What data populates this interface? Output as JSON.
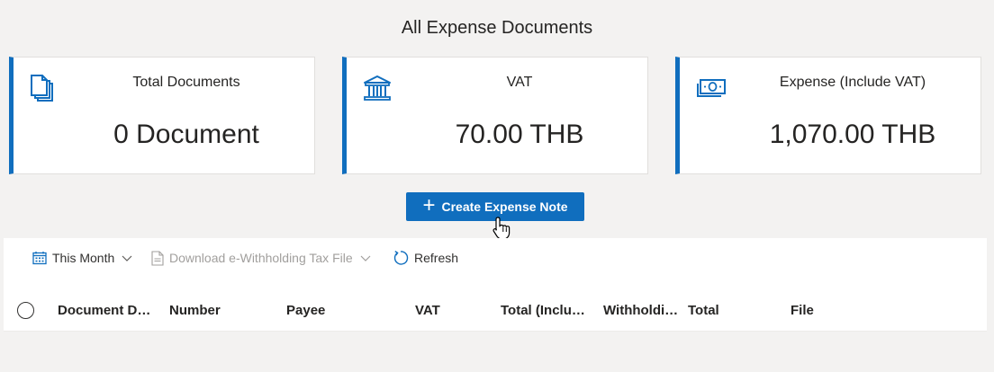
{
  "page": {
    "title": "All Expense Documents"
  },
  "cards": [
    {
      "label": "Total Documents",
      "value": "0 Document",
      "icon": "documents-icon"
    },
    {
      "label": "VAT",
      "value": "70.00 THB",
      "icon": "bank-icon"
    },
    {
      "label": "Expense (Include VAT)",
      "value": "1,070.00 THB",
      "icon": "money-icon"
    }
  ],
  "actions": {
    "create_label": "Create Expense Note"
  },
  "toolbar": {
    "period_label": "This Month",
    "download_label": "Download e-Withholding Tax File",
    "refresh_label": "Refresh"
  },
  "table": {
    "columns": [
      "Document Da…",
      "Number",
      "Payee",
      "VAT",
      "Total (Inclu…",
      "Withholdi…",
      "Total",
      "File"
    ]
  },
  "colors": {
    "accent": "#106ebe",
    "background": "#f3f2f1",
    "card_border": "#e1dfdd"
  }
}
